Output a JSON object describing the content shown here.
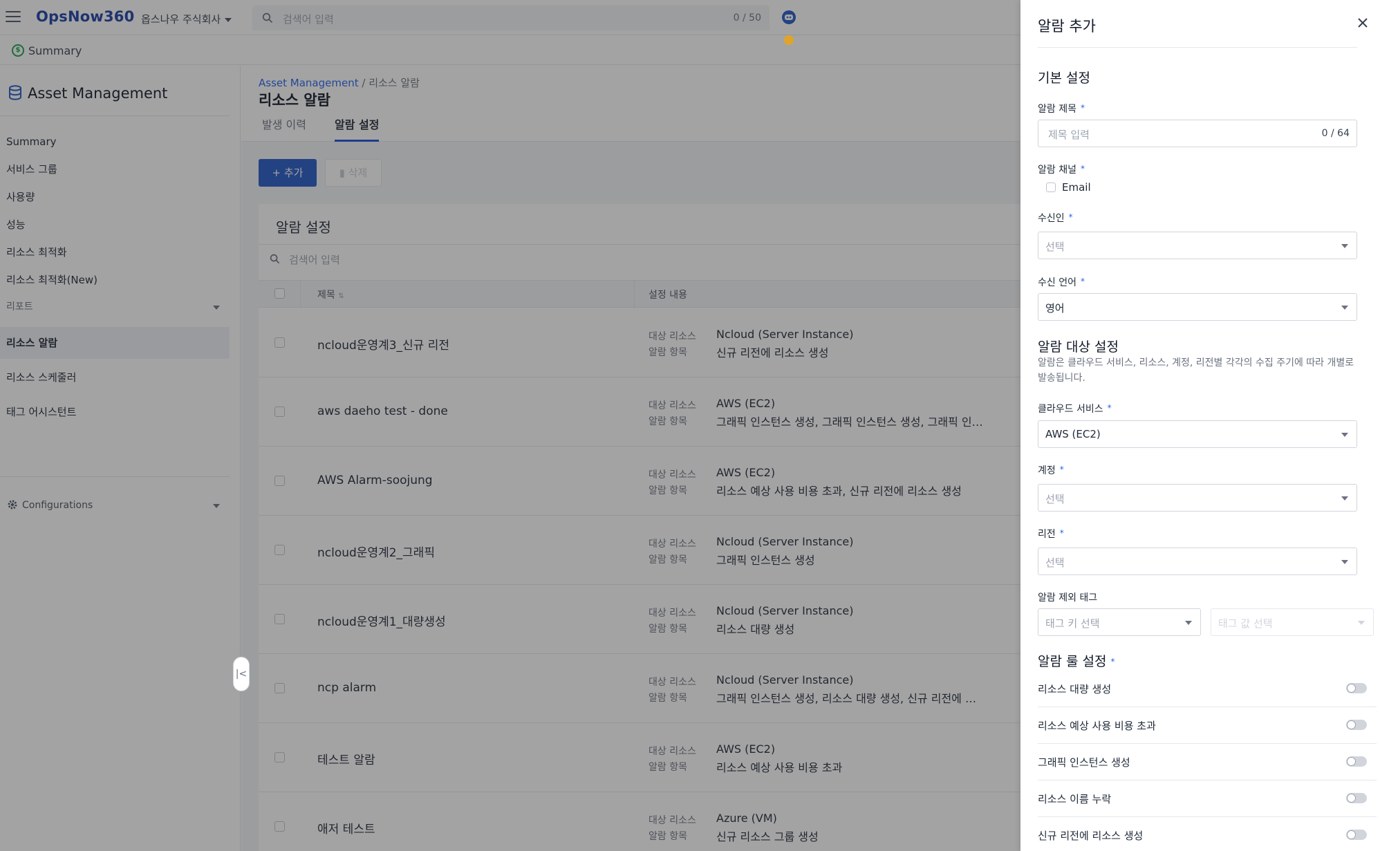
{
  "topbar": {
    "logo": "OpsNow360",
    "company": "옵스나우 주식회사",
    "search_placeholder": "검색어 입력",
    "search_count": "0 / 50"
  },
  "subbar": {
    "label": "Summary"
  },
  "sidebar": {
    "title": "Asset Management",
    "items": [
      {
        "label": "Summary"
      },
      {
        "label": "서비스 그룹"
      },
      {
        "label": "사용량"
      },
      {
        "label": "성능"
      },
      {
        "label": "리소스 최적화"
      },
      {
        "label": "리소스 최적화(New)"
      }
    ],
    "group_label": "리포트",
    "group_items": [
      {
        "label": "리소스 알람"
      },
      {
        "label": "리소스 스케줄러"
      },
      {
        "label": "태그 어시스턴트"
      }
    ],
    "config_label": "Configurations"
  },
  "main": {
    "breadcrumb_link": "Asset Management",
    "breadcrumb_sep": " / ",
    "breadcrumb_current": "리소스 알람",
    "page_title": "리소스 알람",
    "tabs": [
      {
        "label": "발생 이력"
      },
      {
        "label": "알람 설정"
      }
    ],
    "add_button": "+ 추가",
    "delete_button": "삭제",
    "card_title": "알람 설정",
    "table_search_placeholder": "검색어 입력",
    "columns": {
      "title": "제목",
      "content": "설정 내용"
    },
    "row_labels": {
      "target": "대상 리소스",
      "items": "알람 항목"
    },
    "rows": [
      {
        "title": "ncloud운영계3_신규 리전",
        "target": "Ncloud (Server Instance)",
        "items": "신규 리전에 리소스 생성"
      },
      {
        "title": "aws daeho test - done",
        "target": "AWS (EC2)",
        "items": "그래픽 인스턴스 생성, 그래픽 인스턴스 생성, 그래픽 인…"
      },
      {
        "title": "AWS Alarm-soojung",
        "target": "AWS (EC2)",
        "items": "리소스 예상 사용 비용 초과, 신규 리전에 리소스 생성"
      },
      {
        "title": "ncloud운영계2_그래픽",
        "target": "Ncloud (Server Instance)",
        "items": "그래픽 인스턴스 생성"
      },
      {
        "title": "ncloud운영계1_대량생성",
        "target": "Ncloud (Server Instance)",
        "items": "리소스 대량 생성"
      },
      {
        "title": "ncp alarm",
        "target": "Ncloud (Server Instance)",
        "items": "그래픽 인스턴스 생성, 리소스 대량 생성, 신규 리전에 …"
      },
      {
        "title": "테스트 알람",
        "target": "AWS (EC2)",
        "items": "리소스 예상 사용 비용 초과"
      },
      {
        "title": "애저 테스트",
        "target": "Azure (VM)",
        "items": "신규 리소스 그룹 생성"
      }
    ]
  },
  "drawer": {
    "title": "알람 추가",
    "basic_section": "기본 설정",
    "alarm_title_label": "알람 제목",
    "alarm_title_placeholder": "제목 입력",
    "alarm_title_count": "0 / 64",
    "channel_label": "알람 채널",
    "channel_option": "Email",
    "recipient_label": "수신인",
    "recipient_value": "선택",
    "language_label": "수신 언어",
    "language_value": "영어",
    "target_section": "알람 대상 설정",
    "target_desc": "알람은 클라우드 서비스, 리소스, 계정, 리전별 각각의 수집 주기에 따라 개별로 발송됩니다.",
    "cloud_label": "클라우드 서비스",
    "cloud_value": "AWS (EC2)",
    "account_label": "계정",
    "account_value": "선택",
    "region_label": "리전",
    "region_value": "선택",
    "exclude_tag_label": "알람 제외 태그",
    "tag_key_placeholder": "태그 키 선택",
    "tag_value_placeholder": "태그 값 선택",
    "rule_section": "알람 룰 설정",
    "rules": [
      {
        "label": "리소스 대량 생성"
      },
      {
        "label": "리소스 예상 사용 비용 초과"
      },
      {
        "label": "그래픽 인스턴스 생성"
      },
      {
        "label": "리소스 이름 누락"
      },
      {
        "label": "신규 리전에 리소스 생성"
      }
    ],
    "required_mark": "*"
  },
  "colors": {
    "brand": "#1a3fa6",
    "accent": "#2459c7",
    "required": "#2563eb"
  }
}
